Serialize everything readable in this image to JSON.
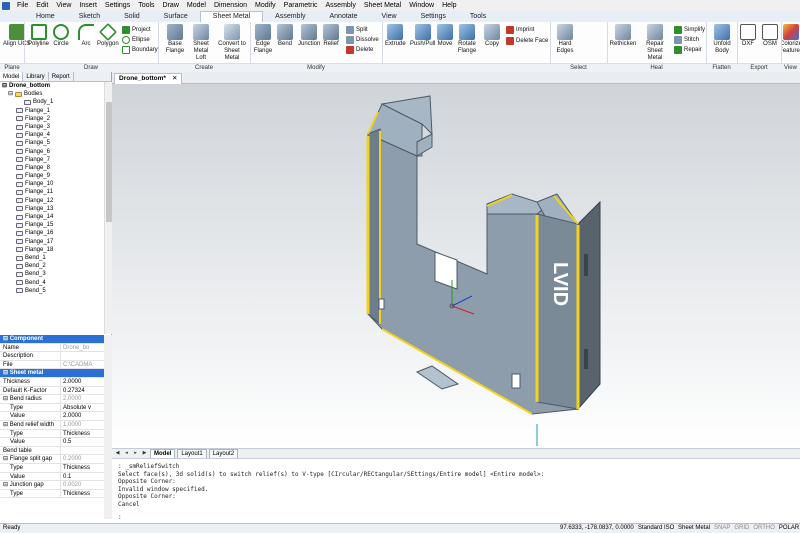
{
  "menu": [
    "File",
    "Edit",
    "View",
    "Insert",
    "Settings",
    "Tools",
    "Draw",
    "Model",
    "Dimension",
    "Modify",
    "Parametric",
    "Assembly",
    "Sheet Metal",
    "Window",
    "Help"
  ],
  "ribbon_tabs": [
    {
      "label": "Home"
    },
    {
      "label": "Sketch"
    },
    {
      "label": "Solid"
    },
    {
      "label": "Surface"
    },
    {
      "label": "Sheet Metal"
    },
    {
      "label": "Assembly"
    },
    {
      "label": "Annotate"
    },
    {
      "label": "View"
    },
    {
      "label": "Settings"
    },
    {
      "label": "Tools"
    }
  ],
  "active_tab": "Sheet Metal",
  "ribbon": {
    "plane": {
      "align": "Align UCS"
    },
    "draw": {
      "polyline": "Polyline",
      "circle": "Circle",
      "arc": "Arc",
      "polygon": "Polygon",
      "project": "Project",
      "ellipse": "Ellipse",
      "boundary": "Boundary"
    },
    "create": {
      "base_flange": "Base Flange",
      "sheet_metal_loft": "Sheet Metal Loft",
      "convert": "Convert to Sheet Metal"
    },
    "modify": {
      "edge_flange": "Edge Flange",
      "bend": "Bend",
      "junction": "Junction",
      "relief": "Relief",
      "split": "Split",
      "dissolve": "Dissolve",
      "delete": "Delete"
    },
    "direct": {
      "extrude": "Extrude",
      "pushpull": "Push/Pull",
      "move": "Move",
      "rotate_flange": "Rotate Flange",
      "copy": "Copy",
      "imprint": "Imprint",
      "delete_face": "Delete Face"
    },
    "select": {
      "hard_edges": "Hard Edges"
    },
    "heal": {
      "rethicken": "Rethicken",
      "repair_sm": "Repair Sheet Metal",
      "simplify": "Simplify",
      "stitch": "Stitch",
      "repair": "Repair"
    },
    "flatten": {
      "unfold": "Unfold Body"
    },
    "export": {
      "dxf": "DXF",
      "osm": "OSM"
    },
    "colorize": {
      "color": "Colorize Features"
    }
  },
  "panel_labels": [
    "Plane",
    "Draw",
    "Create",
    "Modify",
    "Select",
    "Heal",
    "Flatten",
    "Export",
    "View"
  ],
  "left_tabs": [
    "Model",
    "Library",
    "Report"
  ],
  "tree": {
    "root": "Drone_bottom",
    "bodies": "Bodies",
    "body": "Body_1",
    "items": [
      "Flange_1",
      "Flange_2",
      "Flange_3",
      "Flange_4",
      "Flange_5",
      "Flange_6",
      "Flange_7",
      "Flange_8",
      "Flange_9",
      "Flange_10",
      "Flange_11",
      "Flange_12",
      "Flange_13",
      "Flange_14",
      "Flange_15",
      "Flange_16",
      "Flange_17",
      "Flange_18",
      "Bend_1",
      "Bend_2",
      "Bend_3",
      "Bend_4",
      "Bend_5"
    ]
  },
  "properties": [
    {
      "type": "sec",
      "k": "Component",
      "v": ""
    },
    {
      "type": "row",
      "k": "Name",
      "v": "Drone_bo",
      "gray": true
    },
    {
      "type": "row",
      "k": "Description",
      "v": ""
    },
    {
      "type": "row",
      "k": "File",
      "v": "C:\\CADMA",
      "gray": true
    },
    {
      "type": "sec",
      "k": "Sheet metal",
      "v": ""
    },
    {
      "type": "row",
      "k": "Thickness",
      "v": "2.0000"
    },
    {
      "type": "row",
      "k": "Default K-Factor",
      "v": "0.27324"
    },
    {
      "type": "grp",
      "k": "Bend radius",
      "v": "2.0000",
      "gray": true
    },
    {
      "type": "sub",
      "k": "Type",
      "v": "Absolute v"
    },
    {
      "type": "sub",
      "k": "Value",
      "v": "2.0000"
    },
    {
      "type": "grp",
      "k": "Bend relief width",
      "v": "1.0000",
      "gray": true
    },
    {
      "type": "sub",
      "k": "Type",
      "v": "Thickness"
    },
    {
      "type": "sub",
      "k": "Value",
      "v": "0.5"
    },
    {
      "type": "row",
      "k": "Bend table",
      "v": ""
    },
    {
      "type": "grp",
      "k": "Flange split gap",
      "v": "0.2000",
      "gray": true
    },
    {
      "type": "sub",
      "k": "Type",
      "v": "Thickness"
    },
    {
      "type": "sub",
      "k": "Value",
      "v": "0.1"
    },
    {
      "type": "grp",
      "k": "Junction gap",
      "v": "0.0020",
      "gray": true
    },
    {
      "type": "sub",
      "k": "Type",
      "v": "Thickness"
    }
  ],
  "document_tab": "Drone_bottom*",
  "layout_tabs": [
    "Model",
    "Layout1",
    "Layout2"
  ],
  "command_lines": [
    ": _smReliefSwitch",
    "Select face(s), 3d solid(s) to switch relief(s) to V-type [CIrcular/RECtangular/SEttings/Entire model] <Entire model>:",
    "Opposite Corner:",
    "Invalid window specified.",
    "Opposite Corner:",
    "Cancel"
  ],
  "command_prompt": ":",
  "status": {
    "left": "Ready",
    "coords": "97.6333, -178.0837, 0.0000",
    "standard": "Standard",
    "iso": "ISO",
    "workspace": "Sheet Metal",
    "toggles": [
      "SNAP",
      "GRID",
      "ORTHO",
      "POLAR"
    ]
  },
  "model_logo_text": "LVID",
  "colors": {
    "accent": "#2b70d4",
    "sheet": "#8a9aa8",
    "sheet_dark": "#5f6f7d",
    "bend": "#f2d21c"
  }
}
